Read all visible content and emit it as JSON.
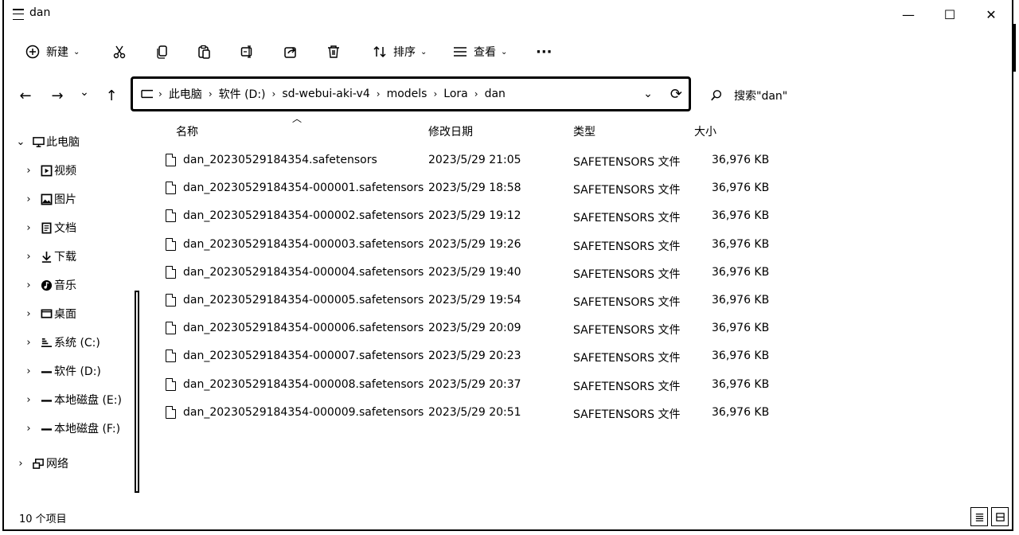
{
  "window": {
    "title": "dan",
    "minimize": "—",
    "maximize": "☐",
    "close": "✕"
  },
  "toolbar": {
    "new_label": "新建",
    "sort_label": "排序",
    "view_label": "查看",
    "more_label": "···"
  },
  "nav": {
    "back": "←",
    "forward": "→",
    "recent": "⌄",
    "up": "↑"
  },
  "address": {
    "segments": [
      "此电脑",
      "软件 (D:)",
      "sd-webui-aki-v4",
      "models",
      "Lora",
      "dan"
    ],
    "separator": "›"
  },
  "search": {
    "placeholder": "搜索\"dan\""
  },
  "columns": {
    "name": "名称",
    "modified": "修改日期",
    "type": "类型",
    "size": "大小"
  },
  "sidebar": {
    "items": [
      {
        "label": "此电脑",
        "icon": "computer-icon",
        "expanded": true
      },
      {
        "label": "视频",
        "icon": "video-icon"
      },
      {
        "label": "图片",
        "icon": "picture-icon"
      },
      {
        "label": "文档",
        "icon": "document-icon"
      },
      {
        "label": "下载",
        "icon": "download-icon"
      },
      {
        "label": "音乐",
        "icon": "music-icon"
      },
      {
        "label": "桌面",
        "icon": "desktop-icon"
      },
      {
        "label": "系统 (C:)",
        "icon": "drive-icon"
      },
      {
        "label": "软件 (D:)",
        "icon": "drive-icon"
      },
      {
        "label": "本地磁盘 (E:)",
        "icon": "drive-icon"
      },
      {
        "label": "本地磁盘 (F:)",
        "icon": "drive-icon"
      },
      {
        "label": "网络",
        "icon": "network-icon"
      }
    ]
  },
  "files": [
    {
      "name": "dan_20230529184354.safetensors",
      "modified": "2023/5/29 21:05",
      "type": "SAFETENSORS 文件",
      "size": "36,976 KB"
    },
    {
      "name": "dan_20230529184354-000001.safetensors",
      "modified": "2023/5/29 18:58",
      "type": "SAFETENSORS 文件",
      "size": "36,976 KB"
    },
    {
      "name": "dan_20230529184354-000002.safetensors",
      "modified": "2023/5/29 19:12",
      "type": "SAFETENSORS 文件",
      "size": "36,976 KB"
    },
    {
      "name": "dan_20230529184354-000003.safetensors",
      "modified": "2023/5/29 19:26",
      "type": "SAFETENSORS 文件",
      "size": "36,976 KB"
    },
    {
      "name": "dan_20230529184354-000004.safetensors",
      "modified": "2023/5/29 19:40",
      "type": "SAFETENSORS 文件",
      "size": "36,976 KB"
    },
    {
      "name": "dan_20230529184354-000005.safetensors",
      "modified": "2023/5/29 19:54",
      "type": "SAFETENSORS 文件",
      "size": "36,976 KB"
    },
    {
      "name": "dan_20230529184354-000006.safetensors",
      "modified": "2023/5/29 20:09",
      "type": "SAFETENSORS 文件",
      "size": "36,976 KB"
    },
    {
      "name": "dan_20230529184354-000007.safetensors",
      "modified": "2023/5/29 20:23",
      "type": "SAFETENSORS 文件",
      "size": "36,976 KB"
    },
    {
      "name": "dan_20230529184354-000008.safetensors",
      "modified": "2023/5/29 20:37",
      "type": "SAFETENSORS 文件",
      "size": "36,976 KB"
    },
    {
      "name": "dan_20230529184354-000009.safetensors",
      "modified": "2023/5/29 20:51",
      "type": "SAFETENSORS 文件",
      "size": "36,976 KB"
    }
  ],
  "status": {
    "count_text": "10 个项目"
  }
}
